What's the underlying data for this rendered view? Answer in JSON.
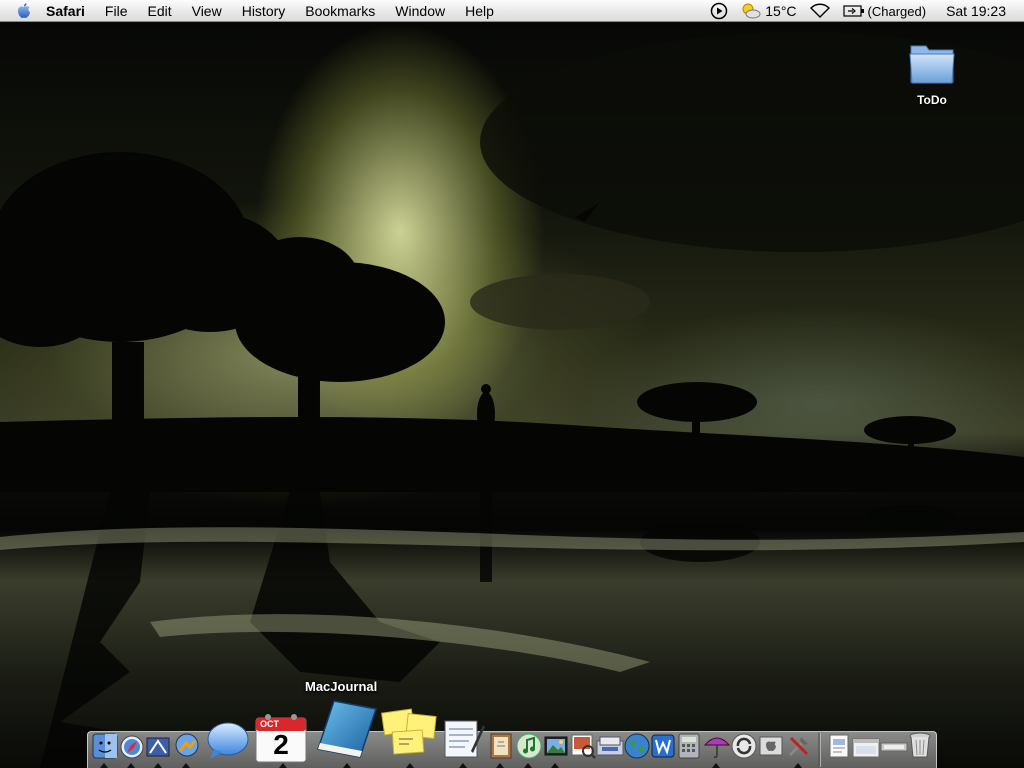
{
  "menubar": {
    "apple_icon": "apple-icon",
    "app_name": "Safari",
    "items": [
      "File",
      "Edit",
      "View",
      "History",
      "Bookmarks",
      "Window",
      "Help"
    ],
    "extras": {
      "temperature": "15°C",
      "battery_status": "(Charged)",
      "clock": "Sat 19:23"
    }
  },
  "desktop": {
    "icons": [
      {
        "label": "ToDo",
        "icon": "folder-icon"
      }
    ]
  },
  "dock": {
    "tooltip": "MacJournal",
    "calendar_month": "OCT",
    "calendar_day": "2",
    "items": [
      "finder-icon",
      "safari-icon",
      "mail-icon",
      "ichat-icon",
      "speech-bubble-icon",
      "ical-icon",
      "macjournal-icon",
      "stickies-icon",
      "textedit-icon",
      "address-book-icon",
      "itunes-icon",
      "iphoto-icon",
      "preview-icon",
      "image-capture-icon",
      "network-globe-icon",
      "word-icon",
      "calculator-icon",
      "umbrella-icon",
      "sync-icon",
      "system-info-icon",
      "utilities-icon",
      "document-icon",
      "window-icon",
      "trash-icon"
    ]
  },
  "colors": {
    "menubar_bg": "#ececec",
    "sky_glow": "#e8ee9a",
    "water": "#3b4030"
  }
}
